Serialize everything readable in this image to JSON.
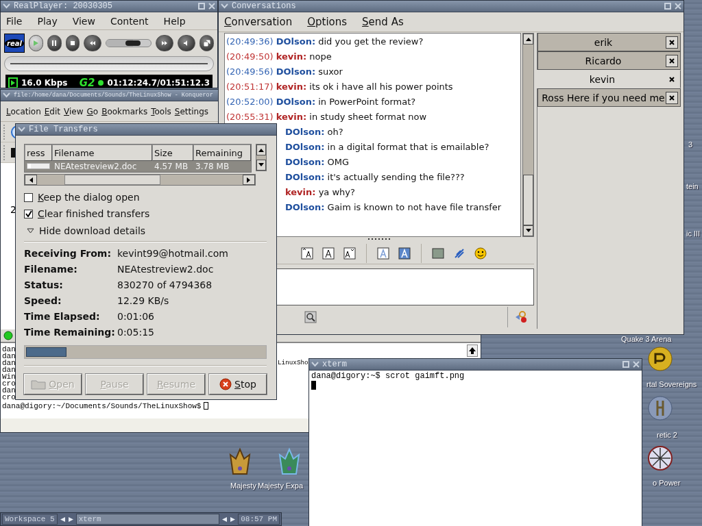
{
  "desktop": {
    "icons": [
      {
        "label": "Majesty",
        "kind": "crown-gold"
      },
      {
        "label": "Majesty Expa",
        "kind": "crown-green"
      },
      {
        "label": "3",
        "kind": "label"
      },
      {
        "label": "tein",
        "kind": "label"
      },
      {
        "label": "ic III",
        "kind": "label"
      },
      {
        "label": "Quake 3 Arena",
        "kind": "label"
      },
      {
        "label": "rtal Sovereigns",
        "kind": "emblem-gold"
      },
      {
        "label": "retic 2",
        "kind": "emblem-silver"
      },
      {
        "label": "o Power",
        "kind": "emblem-compass"
      }
    ]
  },
  "realplayer": {
    "title": "RealPlayer: 20030305",
    "menu": [
      "File",
      "Play",
      "View",
      "Content",
      "Help"
    ],
    "logo": "real",
    "seek": {
      "level": 0.6
    },
    "status": {
      "bitrate": "16.0 Kbps",
      "codec": "G2",
      "time": "01:12:24.7/01:51:12.3"
    }
  },
  "konqueror": {
    "title": "file:/home/dana/Documents/Sounds/TheLinuxShow - Konqueror",
    "menu": [
      "Location",
      "Edit",
      "View",
      "Go",
      "Bookmarks",
      "Tools",
      "Settings"
    ],
    "fragment": "2",
    "terminal_lines": [
      {
        "text": "dan"
      },
      {
        "text": "dan"
      },
      {
        "text": "dan",
        "tail": "LinuxSho"
      },
      {
        "text": "dan"
      },
      {
        "text": "Win"
      },
      {
        "text": "cro"
      },
      {
        "text": "dan"
      },
      {
        "text": "cro"
      }
    ],
    "prompt": "dana@digory:~/Documents/Sounds/TheLinuxShow$"
  },
  "conversations": {
    "title": "Conversations",
    "menu": [
      "Conversation",
      "Options",
      "Send As"
    ],
    "messages": [
      {
        "time": "(20:49:36)",
        "sender": "DOlson:",
        "kind": "them",
        "text": "did you get the review?"
      },
      {
        "time": "(20:49:50)",
        "sender": "kevin:",
        "kind": "me",
        "text": "nope"
      },
      {
        "time": "(20:49:56)",
        "sender": "DOlson:",
        "kind": "them",
        "text": "suxor"
      },
      {
        "time": "(20:51:17)",
        "sender": "kevin:",
        "kind": "me",
        "text": "its ok i have all his power points"
      },
      {
        "time": "(20:52:00)",
        "sender": "DOlson:",
        "kind": "them",
        "text": "in PowerPoint format?"
      },
      {
        "time": "(20:55:31)",
        "sender": "kevin:",
        "kind": "me",
        "text": "in study sheet format now"
      },
      {
        "sender": "DOlson:",
        "kind": "them",
        "text": "oh?"
      },
      {
        "sender": "DOlson:",
        "kind": "them",
        "text": "in a digital format that is emailable?"
      },
      {
        "sender": "DOlson:",
        "kind": "them",
        "text": "OMG"
      },
      {
        "sender": "DOlson:",
        "kind": "them",
        "text": "it's actually sending the file???"
      },
      {
        "sender": "kevin:",
        "kind": "me",
        "text": "ya why?"
      },
      {
        "sender": "DOlson:",
        "kind": "them",
        "text": "Gaim is known to not have file transfer"
      }
    ],
    "tabs": [
      {
        "label": "erik",
        "selected": false
      },
      {
        "label": "Ricardo",
        "selected": false
      },
      {
        "label": "kevin",
        "selected": true
      },
      {
        "label": "Ross Here if you need me",
        "selected": false
      }
    ]
  },
  "file_transfers": {
    "title": "File Transfers",
    "columns": [
      "ress",
      "Filename",
      "Size",
      "Remaining"
    ],
    "rows": [
      {
        "level": 0.17,
        "filename": "NEAtestreview2.doc",
        "size": "4.57 MB",
        "remaining": "3.78 MB",
        "selected": true
      }
    ],
    "options": [
      {
        "label": "Keep the dialog open",
        "checked": false
      },
      {
        "label": "Clear finished transfers",
        "checked": true
      }
    ],
    "expander": {
      "label": "Hide download details",
      "expanded": true
    },
    "details": [
      {
        "label": "Receiving From:",
        "value": "kevint99@hotmail.com"
      },
      {
        "label": "Filename:",
        "value": "NEAtestreview2.doc"
      },
      {
        "label": "Status:",
        "value": "830270 of 4794368"
      },
      {
        "label": "Speed:",
        "value": "12.29 KB/s"
      },
      {
        "label": "Time Elapsed:",
        "value": "0:01:06"
      },
      {
        "label": "Time Remaining:",
        "value": "0:05:15"
      }
    ],
    "progress": {
      "level": 0.17
    },
    "buttons": [
      {
        "label": "Open",
        "kind": "open",
        "disabled": true
      },
      {
        "label": "Pause",
        "kind": "plain",
        "disabled": true
      },
      {
        "label": "Resume",
        "kind": "plain",
        "disabled": true
      },
      {
        "label": "Stop",
        "kind": "stop",
        "disabled": false
      }
    ]
  },
  "xterm": {
    "title": "xterm",
    "lines": [
      "dana@digory:~$ scrot gaimft.png"
    ]
  },
  "taskbar": {
    "workspace": "Workspace 5",
    "task": "xterm",
    "clock": "08:57 PM"
  }
}
